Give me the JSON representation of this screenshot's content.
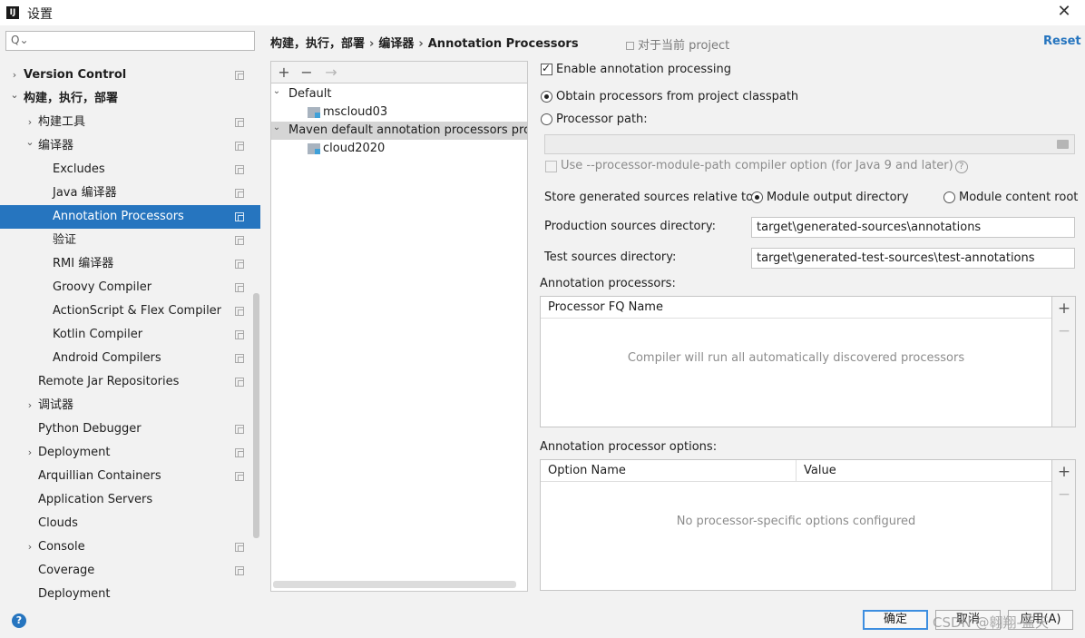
{
  "window": {
    "title": "设置",
    "app_icon": "IJ"
  },
  "sidebar": {
    "search_placeholder": "",
    "items": [
      {
        "label": "Version Control",
        "level": 0,
        "arrow": "›",
        "bold": true,
        "copy": true
      },
      {
        "label": "构建，执行，部署",
        "level": 0,
        "arrow": "⌄",
        "bold": true,
        "copy": false
      },
      {
        "label": "构建工具",
        "level": 1,
        "arrow": "›",
        "bold": false,
        "copy": true
      },
      {
        "label": "编译器",
        "level": 1,
        "arrow": "⌄",
        "bold": false,
        "copy": true
      },
      {
        "label": "Excludes",
        "level": 2,
        "arrow": "",
        "bold": false,
        "copy": true
      },
      {
        "label": "Java 编译器",
        "level": 2,
        "arrow": "",
        "bold": false,
        "copy": true
      },
      {
        "label": "Annotation Processors",
        "level": 2,
        "arrow": "",
        "bold": false,
        "copy": true,
        "selected": true
      },
      {
        "label": "验证",
        "level": 2,
        "arrow": "",
        "bold": false,
        "copy": true
      },
      {
        "label": "RMI 编译器",
        "level": 2,
        "arrow": "",
        "bold": false,
        "copy": true
      },
      {
        "label": "Groovy Compiler",
        "level": 2,
        "arrow": "",
        "bold": false,
        "copy": true
      },
      {
        "label": "ActionScript & Flex Compiler",
        "level": 2,
        "arrow": "",
        "bold": false,
        "copy": true
      },
      {
        "label": "Kotlin Compiler",
        "level": 2,
        "arrow": "",
        "bold": false,
        "copy": true
      },
      {
        "label": "Android Compilers",
        "level": 2,
        "arrow": "",
        "bold": false,
        "copy": true
      },
      {
        "label": "Remote Jar Repositories",
        "level": 1,
        "arrow": "",
        "bold": false,
        "copy": true
      },
      {
        "label": "调试器",
        "level": 1,
        "arrow": "›",
        "bold": false,
        "copy": false
      },
      {
        "label": "Python Debugger",
        "level": 1,
        "arrow": "",
        "bold": false,
        "copy": true
      },
      {
        "label": "Deployment",
        "level": 1,
        "arrow": "›",
        "bold": false,
        "copy": true
      },
      {
        "label": "Arquillian Containers",
        "level": 1,
        "arrow": "",
        "bold": false,
        "copy": true
      },
      {
        "label": "Application Servers",
        "level": 1,
        "arrow": "",
        "bold": false,
        "copy": false
      },
      {
        "label": "Clouds",
        "level": 1,
        "arrow": "",
        "bold": false,
        "copy": false
      },
      {
        "label": "Console",
        "level": 1,
        "arrow": "›",
        "bold": false,
        "copy": true
      },
      {
        "label": "Coverage",
        "level": 1,
        "arrow": "",
        "bold": false,
        "copy": true
      },
      {
        "label": "Deployment",
        "level": 1,
        "arrow": "",
        "bold": false,
        "copy": false
      }
    ]
  },
  "breadcrumb": {
    "parts": [
      "构建，执行，部署",
      "编译器",
      "Annotation Processors"
    ],
    "separator": "›",
    "scope": "对于当前 project",
    "reset": "Reset"
  },
  "profiles": {
    "toolbar": {
      "add": "+",
      "remove": "−",
      "move": "→"
    },
    "rows": [
      {
        "label": "Default",
        "type": "group",
        "expanded": true
      },
      {
        "label": "mscloud03",
        "type": "module"
      },
      {
        "label": "Maven default annotation processors profile",
        "type": "group",
        "expanded": true,
        "highlight": true
      },
      {
        "label": "cloud2020",
        "type": "module"
      }
    ]
  },
  "settings": {
    "enable_label": "Enable annotation processing",
    "enable_checked": true,
    "obtain_label": "Obtain processors from project classpath",
    "obtain_selected": true,
    "path_label": "Processor path:",
    "path_value": "",
    "module_path_label": "Use --processor-module-path compiler option (for Java 9 and later)",
    "help_glyph": "?",
    "store_label": "Store generated sources relative to:",
    "store_options": [
      "Module output directory",
      "Module content root"
    ],
    "store_selected": "Module output directory",
    "prod_dir_label": "Production sources directory:",
    "prod_dir_value": "target\\generated-sources\\annotations",
    "test_dir_label": "Test sources directory:",
    "test_dir_value": "target\\generated-test-sources\\test-annotations"
  },
  "processors_table": {
    "section_label": "Annotation processors:",
    "header": "Processor FQ Name",
    "empty_text": "Compiler will run all automatically discovered processors"
  },
  "options_table": {
    "section_label": "Annotation processor options:",
    "headers": [
      "Option Name",
      "Value"
    ],
    "empty_text": "No processor-specific options configured"
  },
  "footer": {
    "ok": "确定",
    "cancel": "取消",
    "apply": "应用(A)",
    "help": "?",
    "watermark": "CSDN @翱翔-蓝天"
  },
  "colors": {
    "accent": "#2675bf",
    "selection": "#2675bf"
  }
}
